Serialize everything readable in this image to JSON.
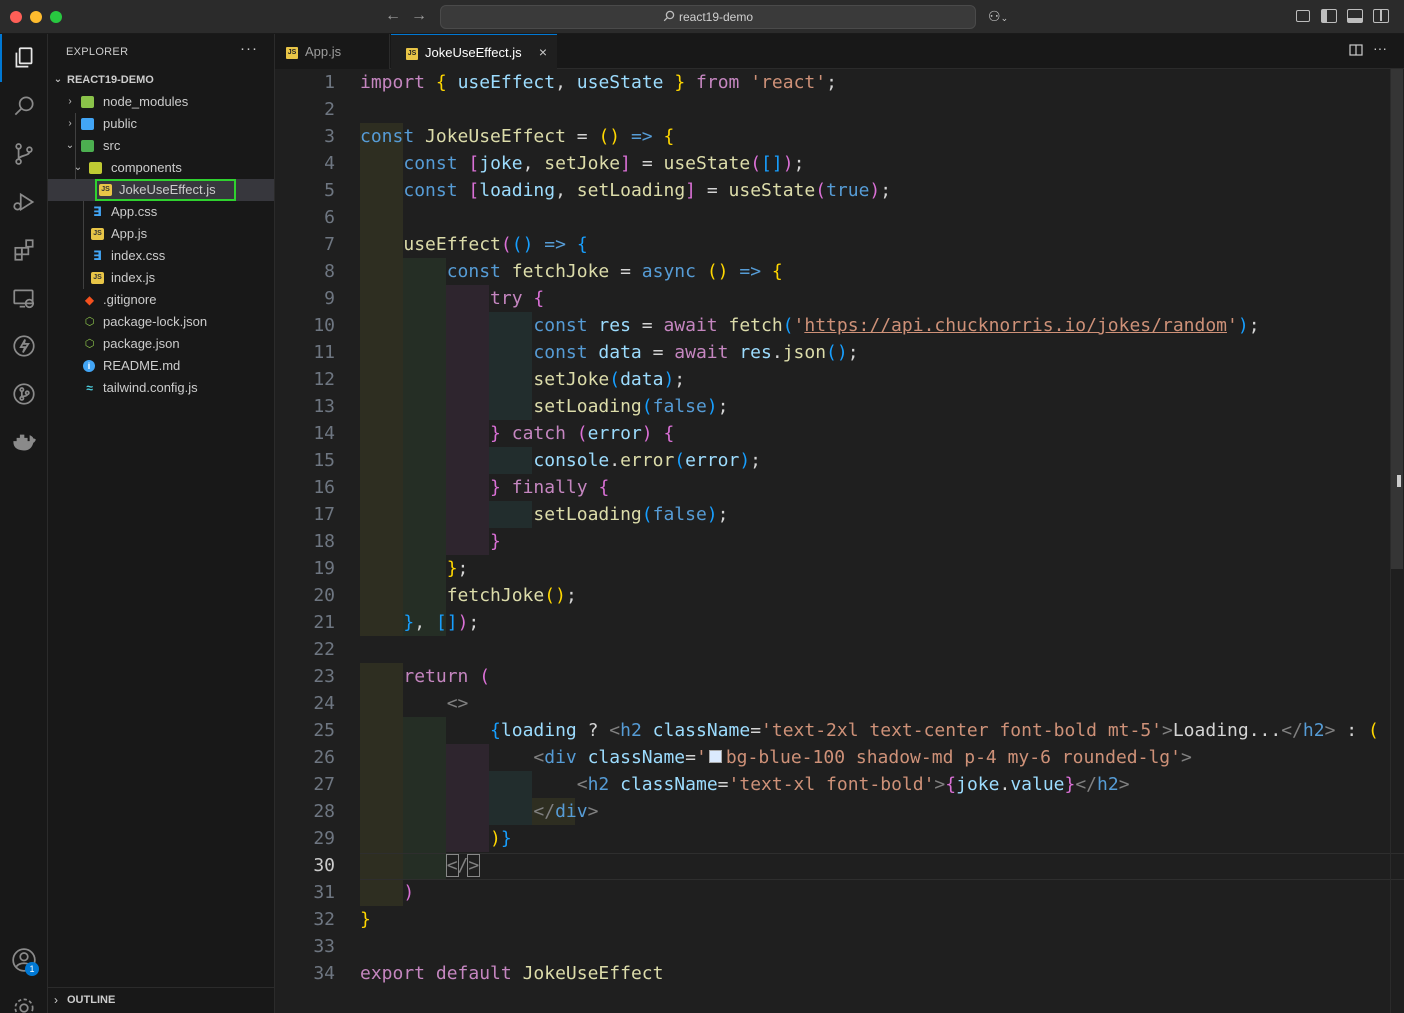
{
  "window": {
    "title": "react19-demo",
    "back_arrow": "←",
    "forward_arrow": "→",
    "copilot_glyph": "⚇",
    "colors": {
      "close": "#fe5f57",
      "minimize": "#febc2e",
      "maximize": "#28c840",
      "accent": "#0078d4"
    }
  },
  "activity_bar": {
    "items": [
      "explorer-icon",
      "search-icon",
      "source-control-icon",
      "run-debug-icon",
      "extensions-icon",
      "remote-explorer-icon",
      "lightning-icon",
      "git-graph-icon",
      "docker-icon"
    ],
    "bottom_items": [
      "account-icon",
      "settings-gear-icon"
    ],
    "account_badge": "1"
  },
  "sidebar": {
    "header": "EXPLORER",
    "more": "···",
    "project": "REACT19-DEMO",
    "tree": [
      {
        "label": "node_modules",
        "icon": "folder-node-icon"
      },
      {
        "label": "public",
        "icon": "folder-public-icon"
      },
      {
        "label": "src",
        "icon": "folder-src-icon"
      },
      {
        "label": "components",
        "icon": "folder-components-icon"
      },
      {
        "label": "JokeUseEffect.js",
        "icon": "js-file-icon"
      },
      {
        "label": "App.css",
        "icon": "css-file-icon"
      },
      {
        "label": "App.js",
        "icon": "js-file-icon"
      },
      {
        "label": "index.css",
        "icon": "css-file-icon"
      },
      {
        "label": "index.js",
        "icon": "js-file-icon"
      },
      {
        "label": ".gitignore",
        "icon": "git-icon"
      },
      {
        "label": "package-lock.json",
        "icon": "npm-icon"
      },
      {
        "label": "package.json",
        "icon": "npm-icon"
      },
      {
        "label": "README.md",
        "icon": "info-icon"
      },
      {
        "label": "tailwind.config.js",
        "icon": "tailwind-icon"
      }
    ],
    "outline": "OUTLINE"
  },
  "tabs": [
    {
      "label": "App.js",
      "active": false
    },
    {
      "label": "JokeUseEffect.js",
      "active": true,
      "close": "×"
    }
  ],
  "editor": {
    "current_line": 30,
    "line_numbers": [
      "1",
      "2",
      "3",
      "4",
      "5",
      "6",
      "7",
      "8",
      "9",
      "10",
      "11",
      "12",
      "13",
      "14",
      "15",
      "16",
      "17",
      "18",
      "19",
      "20",
      "21",
      "22",
      "23",
      "24",
      "25",
      "26",
      "27",
      "28",
      "29",
      "30",
      "31",
      "32",
      "33",
      "34"
    ],
    "tokens": {
      "import": "import",
      "from": "from",
      "const": "const",
      "async": "async",
      "await": "await",
      "try": "try",
      "catch": "catch",
      "finally": "finally",
      "return": "return",
      "export": "export",
      "default": "default",
      "useEffect": "useEffect",
      "useState": "useState",
      "JokeUseEffect": "JokeUseEffect",
      "react_str": "'react'",
      "joke": "joke",
      "setJoke": "setJoke",
      "loading": "loading",
      "setLoading": "setLoading",
      "fetchJoke": "fetchJoke",
      "res": "res",
      "data": "data",
      "fetch": "fetch",
      "json": "json",
      "url": "https://api.chucknorris.io/jokes/random",
      "true": "true",
      "false": "false",
      "error": "error",
      "console": "console",
      "error_fn": "error",
      "h2": "h2",
      "div": "div",
      "className": "className",
      "value": "value",
      "cls_h2_loading": "'text-2xl text-center font-bold mt-5'",
      "loading_text": "Loading...",
      "cls_div_open": "'",
      "cls_div_rest": "bg-blue-100 shadow-md p-4 my-6 rounded-lg'",
      "cls_h2_joke": "'text-xl font-bold'"
    }
  }
}
